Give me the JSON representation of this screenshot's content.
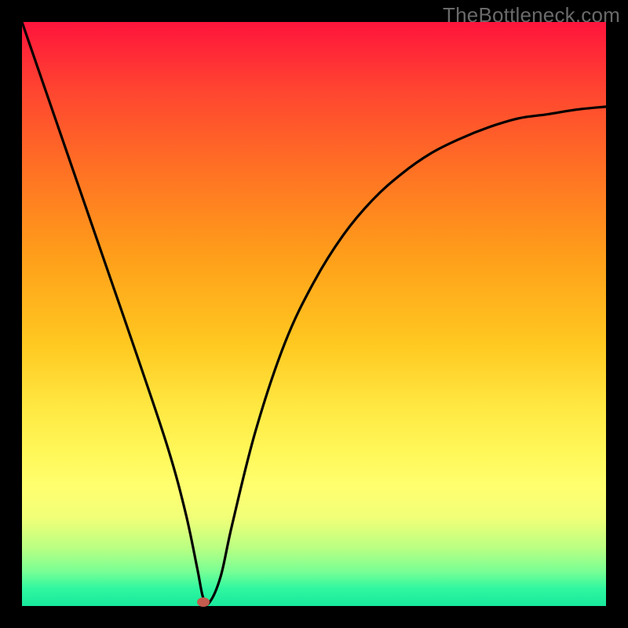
{
  "watermark": "TheBottleneck.com",
  "chart_data": {
    "type": "line",
    "title": "",
    "xlabel": "",
    "ylabel": "",
    "xlim": [
      0,
      100
    ],
    "ylim": [
      0,
      100
    ],
    "series": [
      {
        "name": "curve",
        "x": [
          0,
          5,
          10,
          15,
          20,
          25,
          28,
          30,
          31,
          32,
          34,
          36,
          40,
          45,
          50,
          55,
          60,
          65,
          70,
          75,
          80,
          85,
          90,
          95,
          100
        ],
        "y": [
          100,
          85.5,
          71,
          56.5,
          42,
          27,
          16,
          6.5,
          1.5,
          0.5,
          5,
          14,
          30,
          45,
          55.5,
          63.5,
          69.5,
          74,
          77.5,
          80,
          82,
          83.5,
          84.2,
          85,
          85.5
        ]
      }
    ],
    "marker": {
      "x": 31,
      "y": 0.7
    },
    "colors": {
      "curve": "#000000",
      "marker": "#c35b4e",
      "background_top": "#ff143c",
      "background_bottom": "#18e89c"
    }
  }
}
